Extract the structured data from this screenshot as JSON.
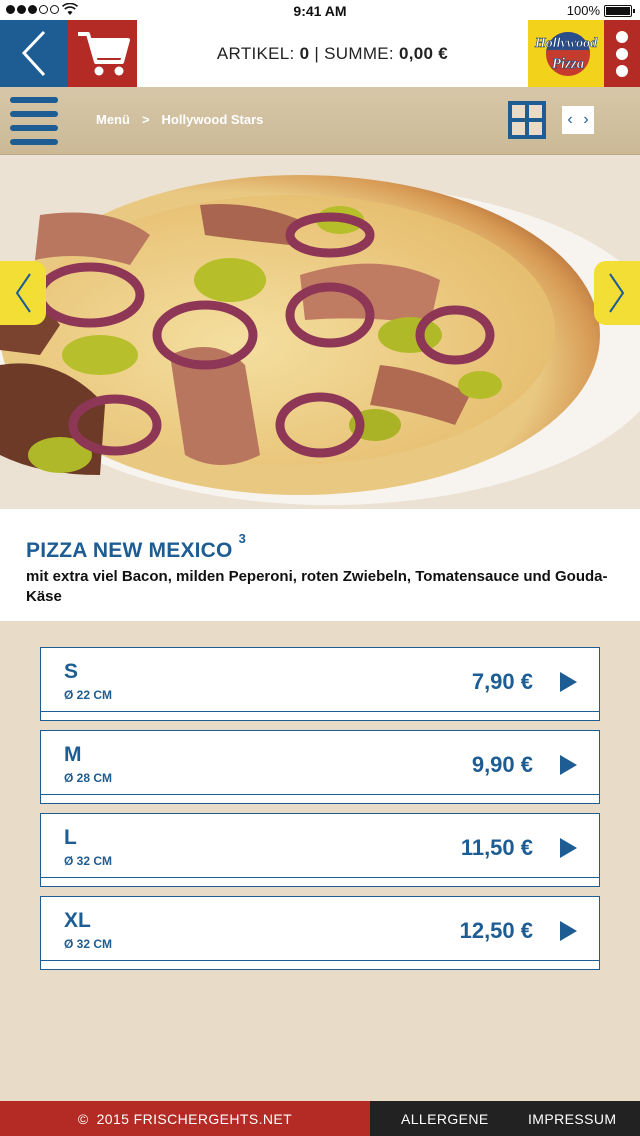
{
  "status_bar": {
    "time": "9:41 AM",
    "battery": "100%",
    "signal_icon": "signal-dots-icon",
    "wifi_icon": "wifi-icon",
    "battery_icon": "battery-icon"
  },
  "top_bar": {
    "back_icon": "chevron-left-icon",
    "cart_icon": "shopping-cart-icon",
    "artikel_label": "ARTIKEL:",
    "artikel_count": "0",
    "separator": "|",
    "summe_label": "SUMME:",
    "summe_value": "0,00 €",
    "logo_alt": "Hollywood Pizza logo",
    "logo_text_1": "Hollywood",
    "logo_text_2": "Pizza",
    "more_icon": "vertical-dots-icon"
  },
  "nav_bar": {
    "menu_icon": "hamburger-icon",
    "breadcrumb": [
      "Menü",
      ">",
      "Hollywood Stars"
    ],
    "grid_icon": "grid-view-icon",
    "pager_prev": "‹",
    "pager_next": "›"
  },
  "hero": {
    "image_alt": "Pizza New Mexico",
    "prev_icon": "chevron-left-icon",
    "next_icon": "chevron-right-icon"
  },
  "product": {
    "title": "PIZZA NEW MEXICO",
    "footnote": "3",
    "description": "mit extra viel Bacon, milden Peperoni, roten Zwiebeln, Tomatensauce und Gouda-Käse"
  },
  "sizes": [
    {
      "label": "S",
      "diameter": "Ø 22 CM",
      "price": "7,90 €"
    },
    {
      "label": "M",
      "diameter": "Ø 28 CM",
      "price": "9,90 €"
    },
    {
      "label": "L",
      "diameter": "Ø 32 CM",
      "price": "11,50 €"
    },
    {
      "label": "XL",
      "diameter": "Ø 32 CM",
      "price": "12,50 €"
    }
  ],
  "footer": {
    "copyright_symbol": "©",
    "copyright": "2015 FRISCHERGEHTS.NET",
    "allergens": "ALLERGENE",
    "imprint": "IMPRESSUM"
  },
  "colors": {
    "brand_blue": "#1d5d93",
    "brand_red": "#b42a24",
    "accent_yellow": "#f2de35",
    "background_beige": "#e8dcc8",
    "nav_tan": "#cbb996"
  }
}
